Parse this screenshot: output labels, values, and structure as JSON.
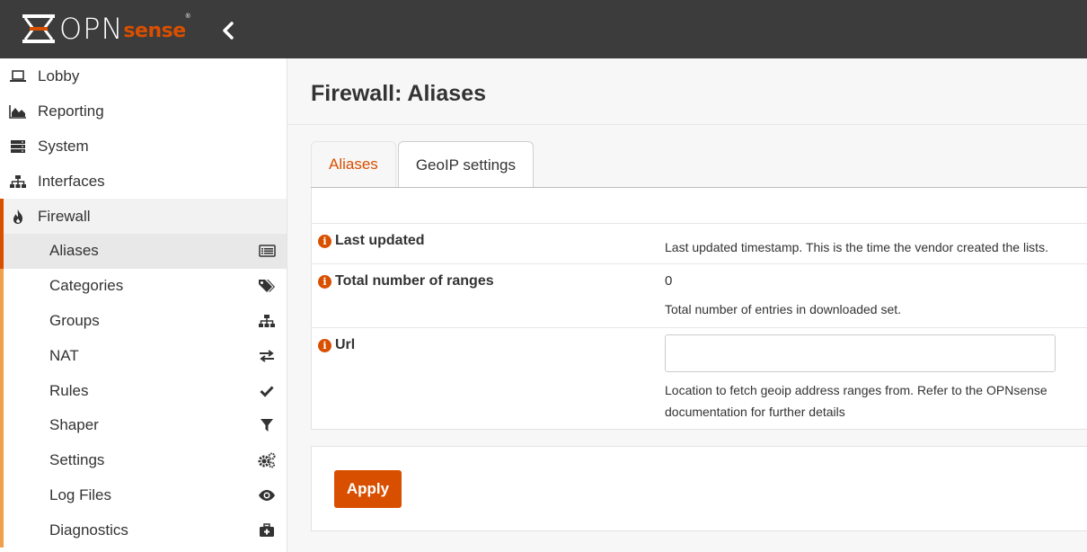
{
  "brand": {
    "name_light": "OPN",
    "name_bold": "sense",
    "registered": "®",
    "accent": "#d94f00",
    "topbar_color": "#3c3c3c"
  },
  "sidebar": {
    "items": [
      {
        "label": "Lobby",
        "icon": "laptop-icon"
      },
      {
        "label": "Reporting",
        "icon": "area-chart-icon"
      },
      {
        "label": "System",
        "icon": "server-icon"
      },
      {
        "label": "Interfaces",
        "icon": "sitemap-icon"
      },
      {
        "label": "Firewall",
        "icon": "fire-icon"
      }
    ],
    "firewall_subitems": [
      {
        "label": "Aliases",
        "icon": "list-alt-icon"
      },
      {
        "label": "Categories",
        "icon": "tags-icon"
      },
      {
        "label": "Groups",
        "icon": "sitemap-icon"
      },
      {
        "label": "NAT",
        "icon": "exchange-icon"
      },
      {
        "label": "Rules",
        "icon": "check-icon"
      },
      {
        "label": "Shaper",
        "icon": "filter-icon"
      },
      {
        "label": "Settings",
        "icon": "cogs-icon"
      },
      {
        "label": "Log Files",
        "icon": "eye-icon"
      },
      {
        "label": "Diagnostics",
        "icon": "medkit-icon"
      }
    ]
  },
  "main": {
    "title": "Firewall: Aliases",
    "tabs": [
      {
        "label": "Aliases",
        "active": false
      },
      {
        "label": "GeoIP settings",
        "active": true
      }
    ],
    "fields": {
      "last_updated": {
        "label": "Last updated",
        "value": "",
        "help": "Last updated timestamp. This is the time the vendor created the lists."
      },
      "total_ranges": {
        "label": "Total number of ranges",
        "value": "0",
        "help": "Total number of entries in downloaded set."
      },
      "url": {
        "label": "Url",
        "value": "",
        "placeholder": "",
        "help": "Location to fetch geoip address ranges from. Refer to the OPNsense documentation for further details"
      }
    },
    "apply_label": "Apply"
  }
}
